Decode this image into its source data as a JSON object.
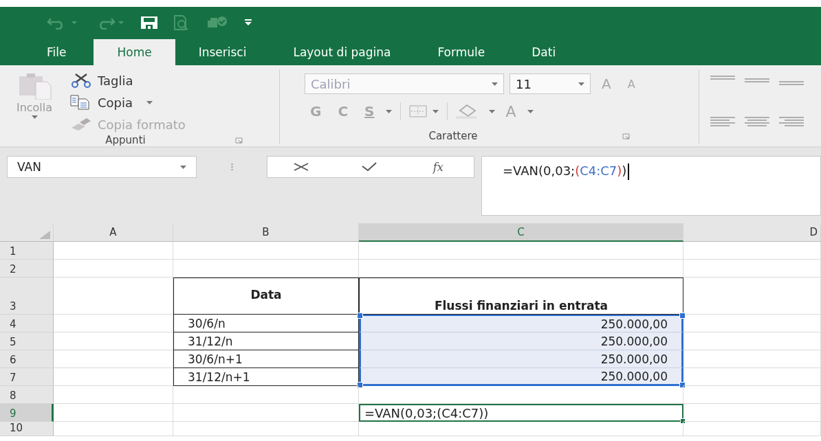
{
  "tabs": [
    {
      "label": "File",
      "selected": false
    },
    {
      "label": "Home",
      "selected": true
    },
    {
      "label": "Inserisci",
      "selected": false
    },
    {
      "label": "Layout di pagina",
      "selected": false
    },
    {
      "label": "Formule",
      "selected": false
    },
    {
      "label": "Dati",
      "selected": false
    }
  ],
  "ribbon": {
    "clipboard": {
      "title": "Appunti",
      "paste": {
        "label": "Incolla",
        "disabled": true
      },
      "items": [
        {
          "kind": "cut",
          "label": "Taglia",
          "disabled": false
        },
        {
          "kind": "copy",
          "label": "Copia",
          "disabled": false
        },
        {
          "kind": "painter",
          "label": "Copia formato",
          "disabled": true
        }
      ]
    },
    "font": {
      "title": "Carattere",
      "disabled": true,
      "font_name": "Calibri",
      "font_size": "11",
      "grow": "A",
      "shrink": "A",
      "bold": "G",
      "italic": "C",
      "underline": "S",
      "font_color": "A"
    }
  },
  "formula_bar": {
    "name_box": "VAN",
    "function_label": "fx",
    "parts": [
      {
        "text": "=VAN(0,03;",
        "kind": "plain"
      },
      {
        "text": "(",
        "kind": "paren"
      },
      {
        "text": "C4:C7",
        "kind": "ref"
      },
      {
        "text": ")",
        "kind": "paren"
      },
      {
        "text": ")",
        "kind": "plain"
      }
    ]
  },
  "columns": [
    {
      "label": "A",
      "selected": false
    },
    {
      "label": "B",
      "selected": false
    },
    {
      "label": "C",
      "selected": true
    },
    {
      "label": "D",
      "selected": false
    }
  ],
  "rows": [
    {
      "header": "1",
      "selected": false,
      "kind": "blank"
    },
    {
      "header": "2",
      "selected": false,
      "kind": "blank"
    },
    {
      "header": "3",
      "selected": false,
      "kind": "heading",
      "b": "Data",
      "c": "Flussi finanziari in entrata"
    },
    {
      "header": "4",
      "selected": false,
      "kind": "data",
      "b": "30/6/n",
      "c": "250.000,00",
      "in_range": true
    },
    {
      "header": "5",
      "selected": false,
      "kind": "data",
      "b": "31/12/n",
      "c": "250.000,00",
      "in_range": true
    },
    {
      "header": "6",
      "selected": false,
      "kind": "data",
      "b": "30/6/n+1",
      "c": "250.000,00",
      "in_range": true
    },
    {
      "header": "7",
      "selected": false,
      "kind": "data",
      "b": "31/12/n+1",
      "c": "250.000,00",
      "in_range": true
    },
    {
      "header": "8",
      "selected": false,
      "kind": "blank"
    },
    {
      "header": "9",
      "selected": true,
      "kind": "formula",
      "c": "=VAN(0,03;(C4:C7))"
    },
    {
      "header": "10",
      "selected": false,
      "kind": "blank"
    }
  ]
}
